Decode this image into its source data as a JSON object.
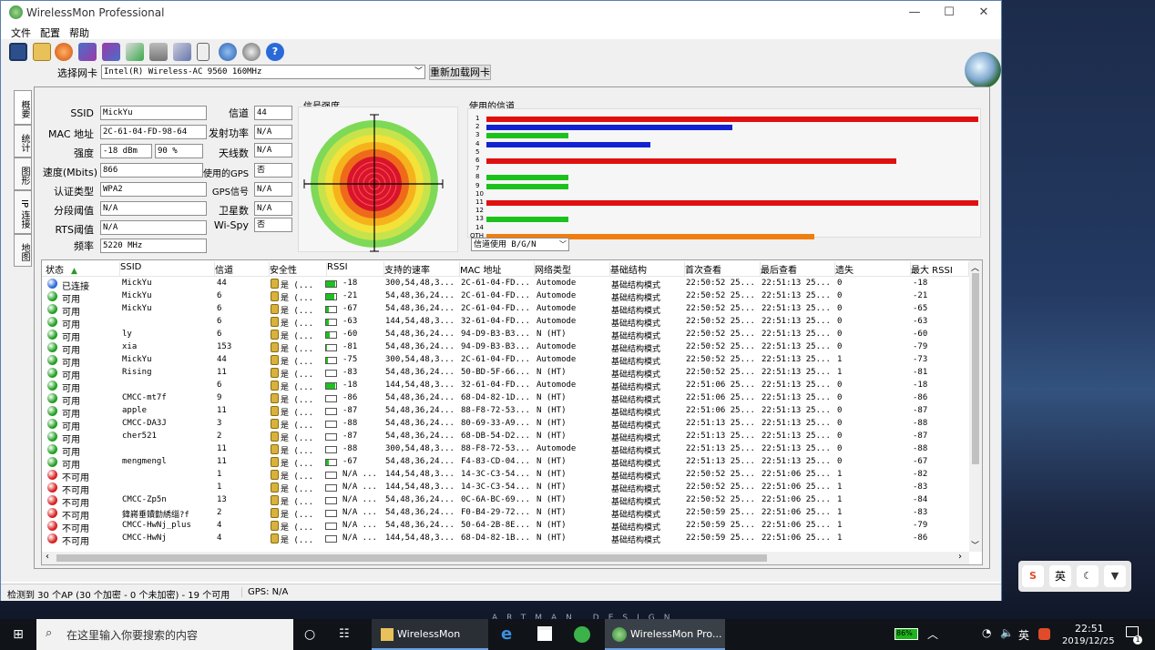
{
  "window": {
    "title": "WirelessMon Professional",
    "controls": [
      "—",
      "☐",
      "✕"
    ]
  },
  "menu": [
    "文件",
    "配置",
    "帮助"
  ],
  "toolbar": {
    "icons": [
      "save-icon",
      "open-folder-icon",
      "record-icon",
      "network-icon",
      "network2-icon",
      "export-icon",
      "print-icon",
      "settings-icon",
      "document-icon",
      "globe-icon",
      "gps-icon",
      "help-icon"
    ],
    "help_glyph": "?"
  },
  "adapter": {
    "label": "选择网卡",
    "value": "Intel(R) Wireless-AC 9560 160MHz",
    "reload_button": "重新加载网卡"
  },
  "side_tabs": [
    "概要",
    "统计",
    "图形",
    "IP 连接",
    "地图"
  ],
  "info": {
    "ssid_label": "SSID",
    "ssid": "MickYu",
    "mac_label": "MAC 地址",
    "mac": "2C-61-04-FD-98-64",
    "strength_label": "强度",
    "strength_dbm": "-18 dBm",
    "strength_pct": "90 %",
    "speed_label": "速度(Mbits)",
    "speed": "866",
    "auth_label": "认证类型",
    "auth": "WPA2",
    "frag_label": "分段阈值",
    "frag": "N/A",
    "rts_label": "RTS阈值",
    "rts": "N/A",
    "freq_label": "频率",
    "freq": "5220 MHz",
    "channel_label": "信道",
    "channel": "44",
    "txpower_label": "发射功率",
    "txpower": "N/A",
    "antenna_label": "天线数",
    "antenna": "N/A",
    "gps_used_label": "使用的GPS",
    "gps_used": "否",
    "gps_signal_label": "GPS信号",
    "gps_signal": "N/A",
    "satellites_label": "卫星数",
    "satellites": "N/A",
    "wispy_label": "Wi-Spy",
    "wispy": "否"
  },
  "signal_panel": {
    "title": "信号强度"
  },
  "channel_panel": {
    "title": "使用的信道",
    "dropdown": "信道使用 B/G/N",
    "channel_labels": [
      "1",
      "2",
      "3",
      "4",
      "5",
      "6",
      "7",
      "8",
      "9",
      "10",
      "11",
      "12",
      "13",
      "14",
      "OTH"
    ],
    "bars": [
      {
        "ch": "1",
        "color": "#e01010",
        "len": 1.0
      },
      {
        "ch": "2",
        "color": "#1222d0",
        "len": 0.5
      },
      {
        "ch": "3",
        "color": "#1cc21c",
        "len": 0.167
      },
      {
        "ch": "4",
        "color": "#1222d0",
        "len": 0.333
      },
      {
        "ch": "6",
        "color": "#e01010",
        "len": 0.833
      },
      {
        "ch": "8",
        "color": "#1cc21c",
        "len": 0.167
      },
      {
        "ch": "9",
        "color": "#1cc21c",
        "len": 0.167
      },
      {
        "ch": "11",
        "color": "#e01010",
        "len": 1.0
      },
      {
        "ch": "13",
        "color": "#1cc21c",
        "len": 0.167
      },
      {
        "ch": "OTH",
        "color": "#f07d10",
        "len": 0.667
      }
    ]
  },
  "table": {
    "headers": [
      "状态",
      "SSID",
      "信道",
      "安全性",
      "RSSI",
      "支持的速率",
      "MAC 地址",
      "网络类型",
      "基础结构",
      "首次查看",
      "最后查看",
      "遗失",
      "最大 RSSI"
    ],
    "sort_icon": "▲",
    "rows": [
      {
        "dot": "#2a6ad8",
        "status": "已连接",
        "ssid": "MickYu",
        "ch": "44",
        "sec": "是 (...",
        "rssi": "-18",
        "sig": 0.9,
        "rate": "300,54,48,3...",
        "mac": "2C-61-04-FD...",
        "type": "Automode",
        "infra": "基础结构模式",
        "first": "22:50:52 25...",
        "last": "22:51:13 25...",
        "lost": "0",
        "max": "-18"
      },
      {
        "dot": "#22a022",
        "status": "可用",
        "ssid": "MickYu",
        "ch": "6",
        "sec": "是 (...",
        "rssi": "-21",
        "sig": 0.85,
        "rate": "54,48,36,24...",
        "mac": "2C-61-04-FD...",
        "type": "Automode",
        "infra": "基础结构模式",
        "first": "22:50:52 25...",
        "last": "22:51:13 25...",
        "lost": "0",
        "max": "-21"
      },
      {
        "dot": "#22a022",
        "status": "可用",
        "ssid": "MickYu",
        "ch": "6",
        "sec": "是 (...",
        "rssi": "-67",
        "sig": 0.25,
        "rate": "54,48,36,24...",
        "mac": "2C-61-04-FD...",
        "type": "Automode",
        "infra": "基础结构模式",
        "first": "22:50:52 25...",
        "last": "22:51:13 25...",
        "lost": "0",
        "max": "-65"
      },
      {
        "dot": "#22a022",
        "status": "可用",
        "ssid": "",
        "ch": "6",
        "sec": "是 (...",
        "rssi": "-63",
        "sig": 0.3,
        "rate": "144,54,48,3...",
        "mac": "32-61-04-FD...",
        "type": "Automode",
        "infra": "基础结构模式",
        "first": "22:50:52 25...",
        "last": "22:51:13 25...",
        "lost": "0",
        "max": "-63"
      },
      {
        "dot": "#22a022",
        "status": "可用",
        "ssid": "ly",
        "ch": "6",
        "sec": "是 (...",
        "rssi": "-60",
        "sig": 0.35,
        "rate": "54,48,36,24...",
        "mac": "94-D9-B3-B3...",
        "type": "N (HT)",
        "infra": "基础结构模式",
        "first": "22:50:52 25...",
        "last": "22:51:13 25...",
        "lost": "0",
        "max": "-60"
      },
      {
        "dot": "#22a022",
        "status": "可用",
        "ssid": "xia",
        "ch": "153",
        "sec": "是 (...",
        "rssi": "-81",
        "sig": 0.1,
        "rate": "54,48,36,24...",
        "mac": "94-D9-B3-B3...",
        "type": "Automode",
        "infra": "基础结构模式",
        "first": "22:50:52 25...",
        "last": "22:51:13 25...",
        "lost": "0",
        "max": "-79"
      },
      {
        "dot": "#22a022",
        "status": "可用",
        "ssid": "MickYu",
        "ch": "44",
        "sec": "是 (...",
        "rssi": "-75",
        "sig": 0.15,
        "rate": "300,54,48,3...",
        "mac": "2C-61-04-FD...",
        "type": "Automode",
        "infra": "基础结构模式",
        "first": "22:50:52 25...",
        "last": "22:51:13 25...",
        "lost": "1",
        "max": "-73"
      },
      {
        "dot": "#22a022",
        "status": "可用",
        "ssid": "Rising",
        "ch": "11",
        "sec": "是 (...",
        "rssi": "-83",
        "sig": 0.0,
        "rate": "54,48,36,24...",
        "mac": "50-BD-5F-66...",
        "type": "N (HT)",
        "infra": "基础结构模式",
        "first": "22:50:52 25...",
        "last": "22:51:13 25...",
        "lost": "1",
        "max": "-81"
      },
      {
        "dot": "#22a022",
        "status": "可用",
        "ssid": "",
        "ch": "6",
        "sec": "是 (...",
        "rssi": "-18",
        "sig": 0.9,
        "rate": "144,54,48,3...",
        "mac": "32-61-04-FD...",
        "type": "Automode",
        "infra": "基础结构模式",
        "first": "22:51:06 25...",
        "last": "22:51:13 25...",
        "lost": "0",
        "max": "-18"
      },
      {
        "dot": "#22a022",
        "status": "可用",
        "ssid": "CMCC-mt7f",
        "ch": "9",
        "sec": "是 (...",
        "rssi": "-86",
        "sig": 0.0,
        "rate": "54,48,36,24...",
        "mac": "68-D4-82-1D...",
        "type": "N (HT)",
        "infra": "基础结构模式",
        "first": "22:51:06 25...",
        "last": "22:51:13 25...",
        "lost": "0",
        "max": "-86"
      },
      {
        "dot": "#22a022",
        "status": "可用",
        "ssid": "apple",
        "ch": "11",
        "sec": "是 (...",
        "rssi": "-87",
        "sig": 0.0,
        "rate": "54,48,36,24...",
        "mac": "88-F8-72-53...",
        "type": "N (HT)",
        "infra": "基础结构模式",
        "first": "22:51:06 25...",
        "last": "22:51:13 25...",
        "lost": "0",
        "max": "-87"
      },
      {
        "dot": "#22a022",
        "status": "可用",
        "ssid": "CMCC-DA3J",
        "ch": "3",
        "sec": "是 (...",
        "rssi": "-88",
        "sig": 0.0,
        "rate": "54,48,36,24...",
        "mac": "80-69-33-A9...",
        "type": "N (HT)",
        "infra": "基础结构模式",
        "first": "22:51:13 25...",
        "last": "22:51:13 25...",
        "lost": "0",
        "max": "-88"
      },
      {
        "dot": "#22a022",
        "status": "可用",
        "ssid": "cher521",
        "ch": "2",
        "sec": "是 (...",
        "rssi": "-87",
        "sig": 0.0,
        "rate": "54,48,36,24...",
        "mac": "68-DB-54-D2...",
        "type": "N (HT)",
        "infra": "基础结构模式",
        "first": "22:51:13 25...",
        "last": "22:51:13 25...",
        "lost": "0",
        "max": "-87"
      },
      {
        "dot": "#22a022",
        "status": "可用",
        "ssid": "",
        "ch": "11",
        "sec": "是 (...",
        "rssi": "-88",
        "sig": 0.0,
        "rate": "300,54,48,3...",
        "mac": "88-F8-72-53...",
        "type": "Automode",
        "infra": "基础结构模式",
        "first": "22:51:13 25...",
        "last": "22:51:13 25...",
        "lost": "0",
        "max": "-88"
      },
      {
        "dot": "#22a022",
        "status": "可用",
        "ssid": "mengmengl",
        "ch": "11",
        "sec": "是 (...",
        "rssi": "-67",
        "sig": 0.25,
        "rate": "54,48,36,24...",
        "mac": "F4-83-CD-04...",
        "type": "N (HT)",
        "infra": "基础结构模式",
        "first": "22:51:13 25...",
        "last": "22:51:13 25...",
        "lost": "0",
        "max": "-67"
      },
      {
        "dot": "#d82020",
        "status": "不可用",
        "ssid": "",
        "ch": "1",
        "sec": "是 (...",
        "rssi": "N/A ...",
        "sig": 0.0,
        "rate": "144,54,48,3...",
        "mac": "14-3C-C3-54...",
        "type": "N (HT)",
        "infra": "基础结构模式",
        "first": "22:50:52 25...",
        "last": "22:51:06 25...",
        "lost": "1",
        "max": "-82"
      },
      {
        "dot": "#d82020",
        "status": "不可用",
        "ssid": "",
        "ch": "1",
        "sec": "是 (...",
        "rssi": "N/A ...",
        "sig": 0.0,
        "rate": "144,54,48,3...",
        "mac": "14-3C-C3-54...",
        "type": "N (HT)",
        "infra": "基础结构模式",
        "first": "22:50:52 25...",
        "last": "22:51:06 25...",
        "lost": "1",
        "max": "-83"
      },
      {
        "dot": "#d82020",
        "status": "不可用",
        "ssid": "CMCC-Zp5n",
        "ch": "13",
        "sec": "是 (...",
        "rssi": "N/A ...",
        "sig": 0.0,
        "rate": "54,48,36,24...",
        "mac": "0C-6A-BC-69...",
        "type": "N (HT)",
        "infra": "基础结构模式",
        "first": "22:50:52 25...",
        "last": "22:51:06 25...",
        "lost": "1",
        "max": "-84"
      },
      {
        "dot": "#d82020",
        "status": "不可用",
        "ssid": "鍏嶈垂鐨勭綉缁?f",
        "ch": "2",
        "sec": "是 (...",
        "rssi": "N/A ...",
        "sig": 0.0,
        "rate": "54,48,36,24...",
        "mac": "F0-B4-29-72...",
        "type": "N (HT)",
        "infra": "基础结构模式",
        "first": "22:50:59 25...",
        "last": "22:51:06 25...",
        "lost": "1",
        "max": "-83"
      },
      {
        "dot": "#d82020",
        "status": "不可用",
        "ssid": "CMCC-HwNj_plus",
        "ch": "4",
        "sec": "是 (...",
        "rssi": "N/A ...",
        "sig": 0.0,
        "rate": "54,48,36,24...",
        "mac": "50-64-2B-8E...",
        "type": "N (HT)",
        "infra": "基础结构模式",
        "first": "22:50:59 25...",
        "last": "22:51:06 25...",
        "lost": "1",
        "max": "-79"
      },
      {
        "dot": "#d82020",
        "status": "不可用",
        "ssid": "CMCC-HwNj",
        "ch": "4",
        "sec": "是 (...",
        "rssi": "N/A ...",
        "sig": 0.0,
        "rate": "144,54,48,3...",
        "mac": "68-D4-82-1B...",
        "type": "N (HT)",
        "infra": "基础结构模式",
        "first": "22:50:59 25...",
        "last": "22:51:06 25...",
        "lost": "1",
        "max": "-86"
      }
    ]
  },
  "statusbar": {
    "summary": "检测到 30 个AP (30 个加密 - 0 个未加密) - 19 个可用",
    "gps": "GPS: N/A"
  },
  "tray_widget": [
    "英"
  ],
  "taskbar": {
    "search_placeholder": "在这里输入你要搜索的内容",
    "apps": [
      {
        "label": "WirelessMon"
      },
      {
        "label": "WirelessMon Pro..."
      }
    ],
    "battery": "86%",
    "ime": "英",
    "time": "22:51",
    "date": "2019/12/25",
    "notification_count": "1"
  },
  "wallpaper_text": "ARTMAN DESIGN"
}
